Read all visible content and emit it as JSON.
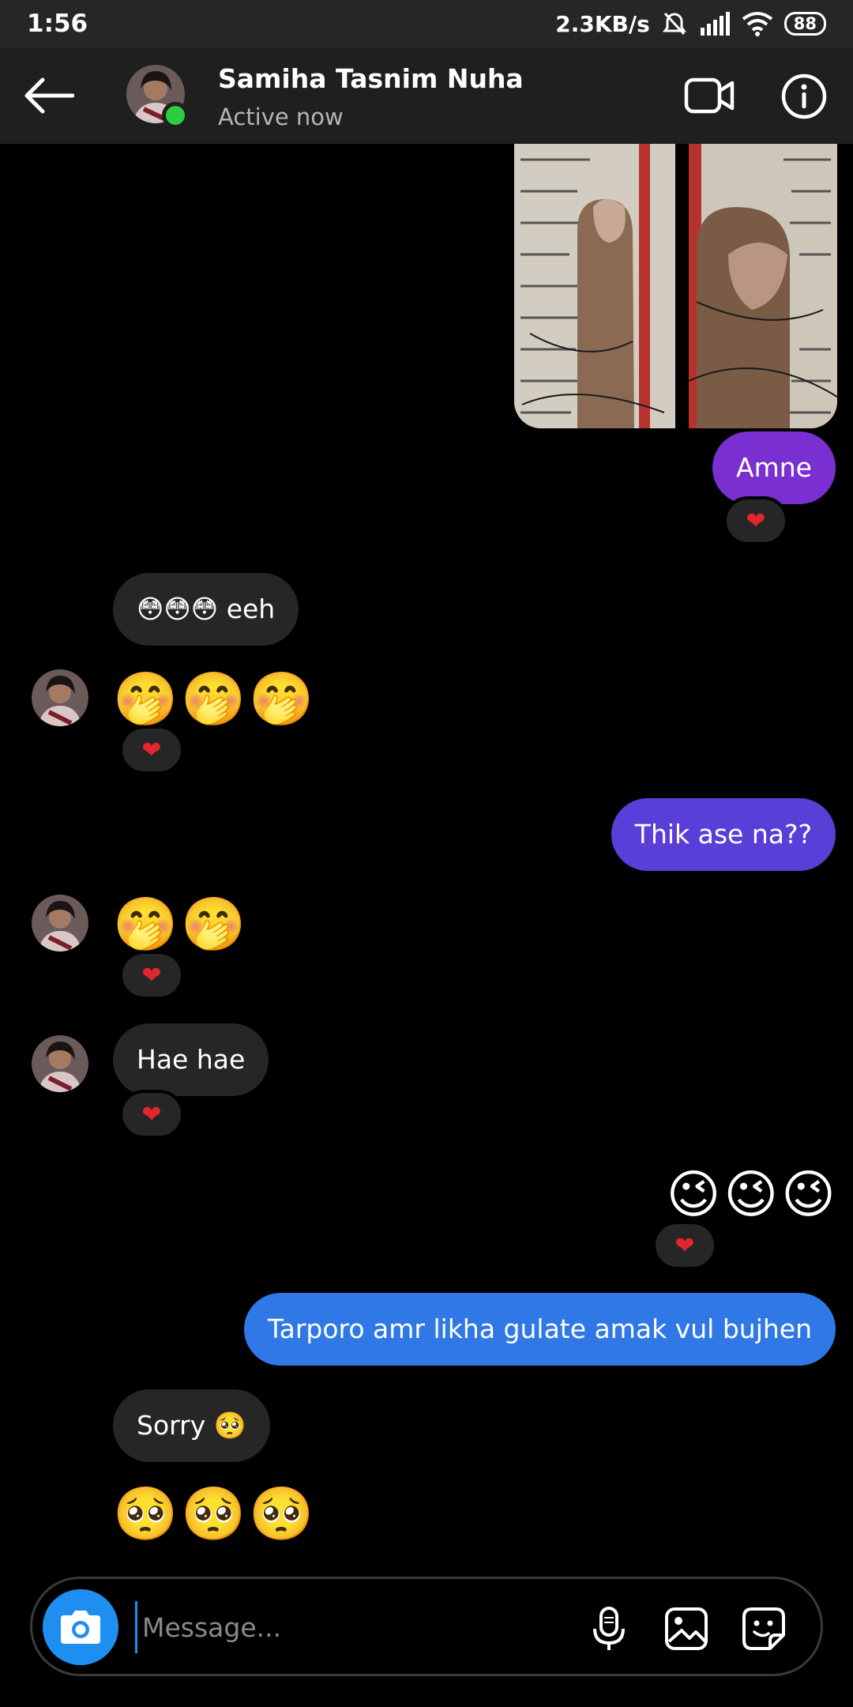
{
  "status_bar": {
    "time": "1:56",
    "speed": "2.3KB/s",
    "battery": "88"
  },
  "header": {
    "name": "Samiha Tasnim Nuha",
    "status": "Active now"
  },
  "messages": {
    "m1": "Amne",
    "m1_reaction": "❤",
    "m2": "😳😳😳 eeh",
    "m3": "🤭🤭🤭",
    "m3_reaction": "❤",
    "m4": "Thik ase na??",
    "m5": "🤭🤭",
    "m5_reaction": "❤",
    "m6": "Hae hae",
    "m6_reaction": "❤",
    "m7": "😉😉😉",
    "m7_reaction": "❤",
    "m8": "Tarporo amr likha gulate amak vul bujhen",
    "m9": "Sorry 🥺",
    "m10": "🥺🥺🥺"
  },
  "composer": {
    "placeholder": "Message..."
  },
  "colors": {
    "bubble_purple": "#7a2fd0",
    "bubble_indigo": "#5a3ed8",
    "bubble_blue": "#2f78e6",
    "incoming": "#262626",
    "reaction_heart": "#e0262f"
  },
  "icons": [
    "back-arrow-icon",
    "video-call-icon",
    "info-icon",
    "camera-icon",
    "microphone-icon",
    "gallery-icon",
    "sticker-icon",
    "heart-icon"
  ]
}
